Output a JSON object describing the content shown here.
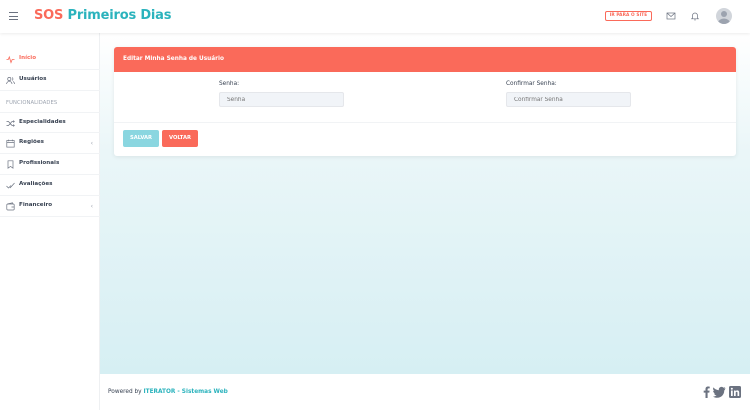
{
  "header": {
    "brand_part1": "SOS",
    "brand_part2": "Primeiros Dias",
    "site_button": "IR PARA O SITE",
    "icons": [
      "menu-icon",
      "mail-icon",
      "bell-icon",
      "avatar"
    ]
  },
  "sidebar": {
    "items": [
      {
        "label": "Início",
        "icon": "activity-icon",
        "active": true
      },
      {
        "label": "Usuários",
        "icon": "users-icon"
      },
      {
        "label": "Especialidades",
        "icon": "shuffle-icon"
      },
      {
        "label": "Regiões",
        "icon": "calendar-icon",
        "has_submenu": true
      },
      {
        "label": "Profissionais",
        "icon": "bookmark-icon"
      },
      {
        "label": "Avaliações",
        "icon": "check-icon"
      },
      {
        "label": "Financeiro",
        "icon": "wallet-icon",
        "has_submenu": true
      }
    ],
    "section_title": "FUNCIONALIDADES",
    "submenu_arrow": "‹"
  },
  "form": {
    "title": "Editar Minha Senha de Usuário",
    "password_label": "Senha:",
    "password_placeholder": "Senha",
    "confirm_label": "Confirmar Senha:",
    "confirm_placeholder": "Confirmar Senha",
    "save_button": "SALVAR",
    "back_button": "VOLTAR"
  },
  "footer": {
    "powered_text": "Powered by",
    "company": "ITERATOR - Sistemas Web",
    "social_icons": [
      "facebook-icon",
      "twitter-icon",
      "linkedin-icon"
    ]
  },
  "colors": {
    "accent": "#fa6a5a",
    "brand_teal": "#2bb3bd",
    "save_button": "#8ad6e0"
  }
}
